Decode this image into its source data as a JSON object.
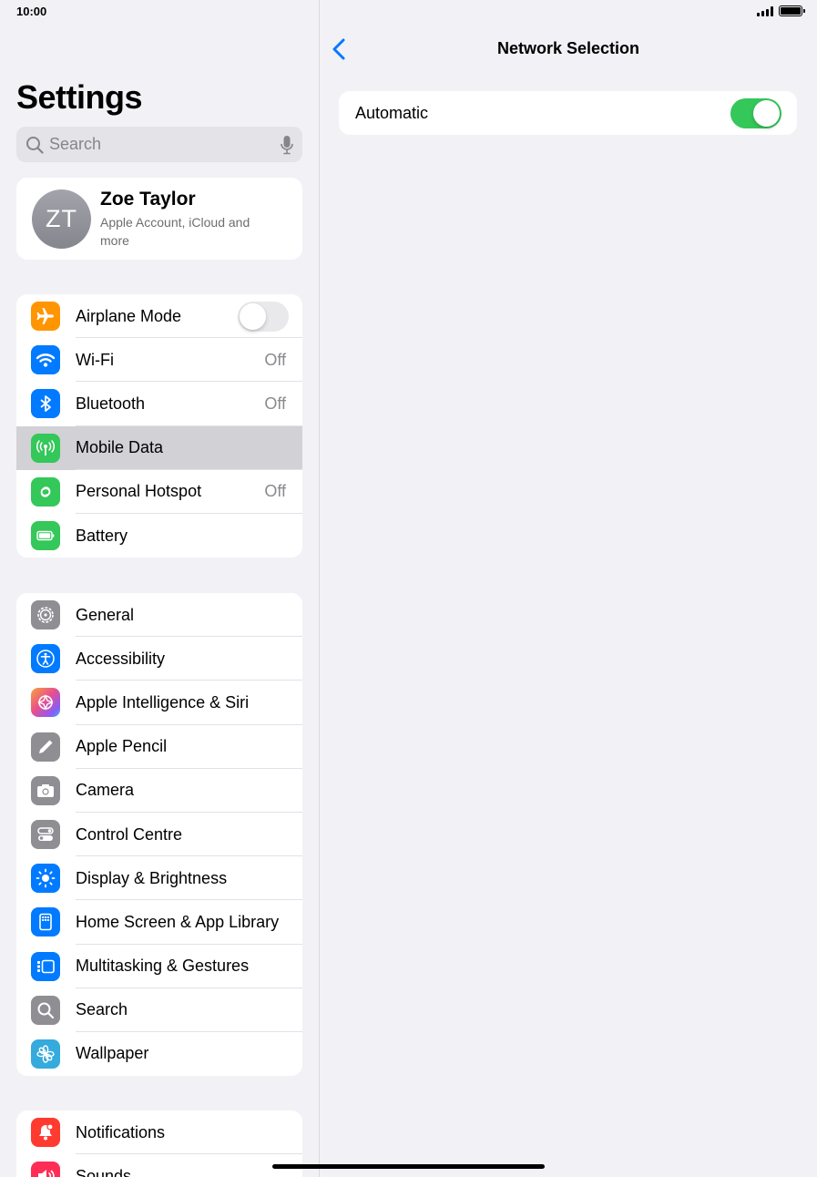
{
  "status": {
    "time": "10:00"
  },
  "sidebar": {
    "title": "Settings",
    "search_placeholder": "Search",
    "profile": {
      "initials": "ZT",
      "name": "Zoe Taylor",
      "subtitle": "Apple Account, iCloud and more"
    },
    "group1": [
      {
        "label": "Airplane Mode",
        "icon": "airplane-icon",
        "color": "#ff9500",
        "toggle": false
      },
      {
        "label": "Wi-Fi",
        "icon": "wifi-icon",
        "color": "#007aff",
        "value": "Off"
      },
      {
        "label": "Bluetooth",
        "icon": "bluetooth-icon",
        "color": "#007aff",
        "value": "Off"
      },
      {
        "label": "Mobile Data",
        "icon": "antenna-icon",
        "color": "#34c759",
        "selected": true
      },
      {
        "label": "Personal Hotspot",
        "icon": "hotspot-icon",
        "color": "#34c759",
        "value": "Off"
      },
      {
        "label": "Battery",
        "icon": "battery-icon",
        "color": "#34c759"
      }
    ],
    "group2": [
      {
        "label": "General",
        "icon": "gear-icon",
        "color": "#8e8e93"
      },
      {
        "label": "Accessibility",
        "icon": "accessibility-icon",
        "color": "#007aff"
      },
      {
        "label": "Apple Intelligence & Siri",
        "icon": "siri-icon",
        "color": "#c86dd7"
      },
      {
        "label": "Apple Pencil",
        "icon": "pencil-icon",
        "color": "#8e8e93"
      },
      {
        "label": "Camera",
        "icon": "camera-icon",
        "color": "#8e8e93"
      },
      {
        "label": "Control Centre",
        "icon": "control-centre-icon",
        "color": "#8e8e93"
      },
      {
        "label": "Display & Brightness",
        "icon": "sun-icon",
        "color": "#007aff"
      },
      {
        "label": "Home Screen & App Library",
        "icon": "home-screen-icon",
        "color": "#007aff"
      },
      {
        "label": "Multitasking & Gestures",
        "icon": "multitasking-icon",
        "color": "#007aff"
      },
      {
        "label": "Search",
        "icon": "search-icon",
        "color": "#8e8e93"
      },
      {
        "label": "Wallpaper",
        "icon": "flower-icon",
        "color": "#35aadc"
      }
    ],
    "group3": [
      {
        "label": "Notifications",
        "icon": "bell-icon",
        "color": "#ff3b30"
      },
      {
        "label": "Sounds",
        "icon": "speaker-icon",
        "color": "#ff2d55"
      }
    ]
  },
  "detail": {
    "title": "Network Selection",
    "automatic_label": "Automatic",
    "automatic_on": true
  }
}
